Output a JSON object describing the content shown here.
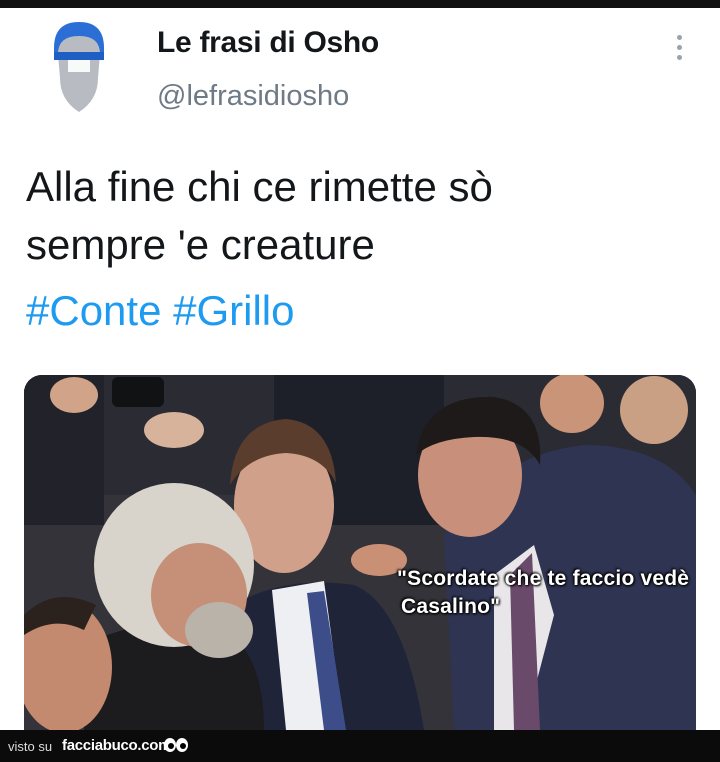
{
  "tweet": {
    "display_name": "Le frasi di Osho",
    "handle": "@lefrasidiosho",
    "text_line1": "Alla fine chi ce rimette sò",
    "text_line2": "sempre 'e creature",
    "hashtags": [
      "#Conte",
      "#Grillo"
    ],
    "avatar_icon": "bearded-man-avatar-icon",
    "more_icon": "vertical-ellipsis-icon",
    "hashtag_color": "#1d9bf0"
  },
  "media": {
    "caption_line1": "\"Scordate che te faccio vedè",
    "caption_line2": "Casalino\""
  },
  "footer": {
    "label": "visto su",
    "site": "facciabuco.com",
    "logo_icon": "eyes-logo-icon"
  }
}
